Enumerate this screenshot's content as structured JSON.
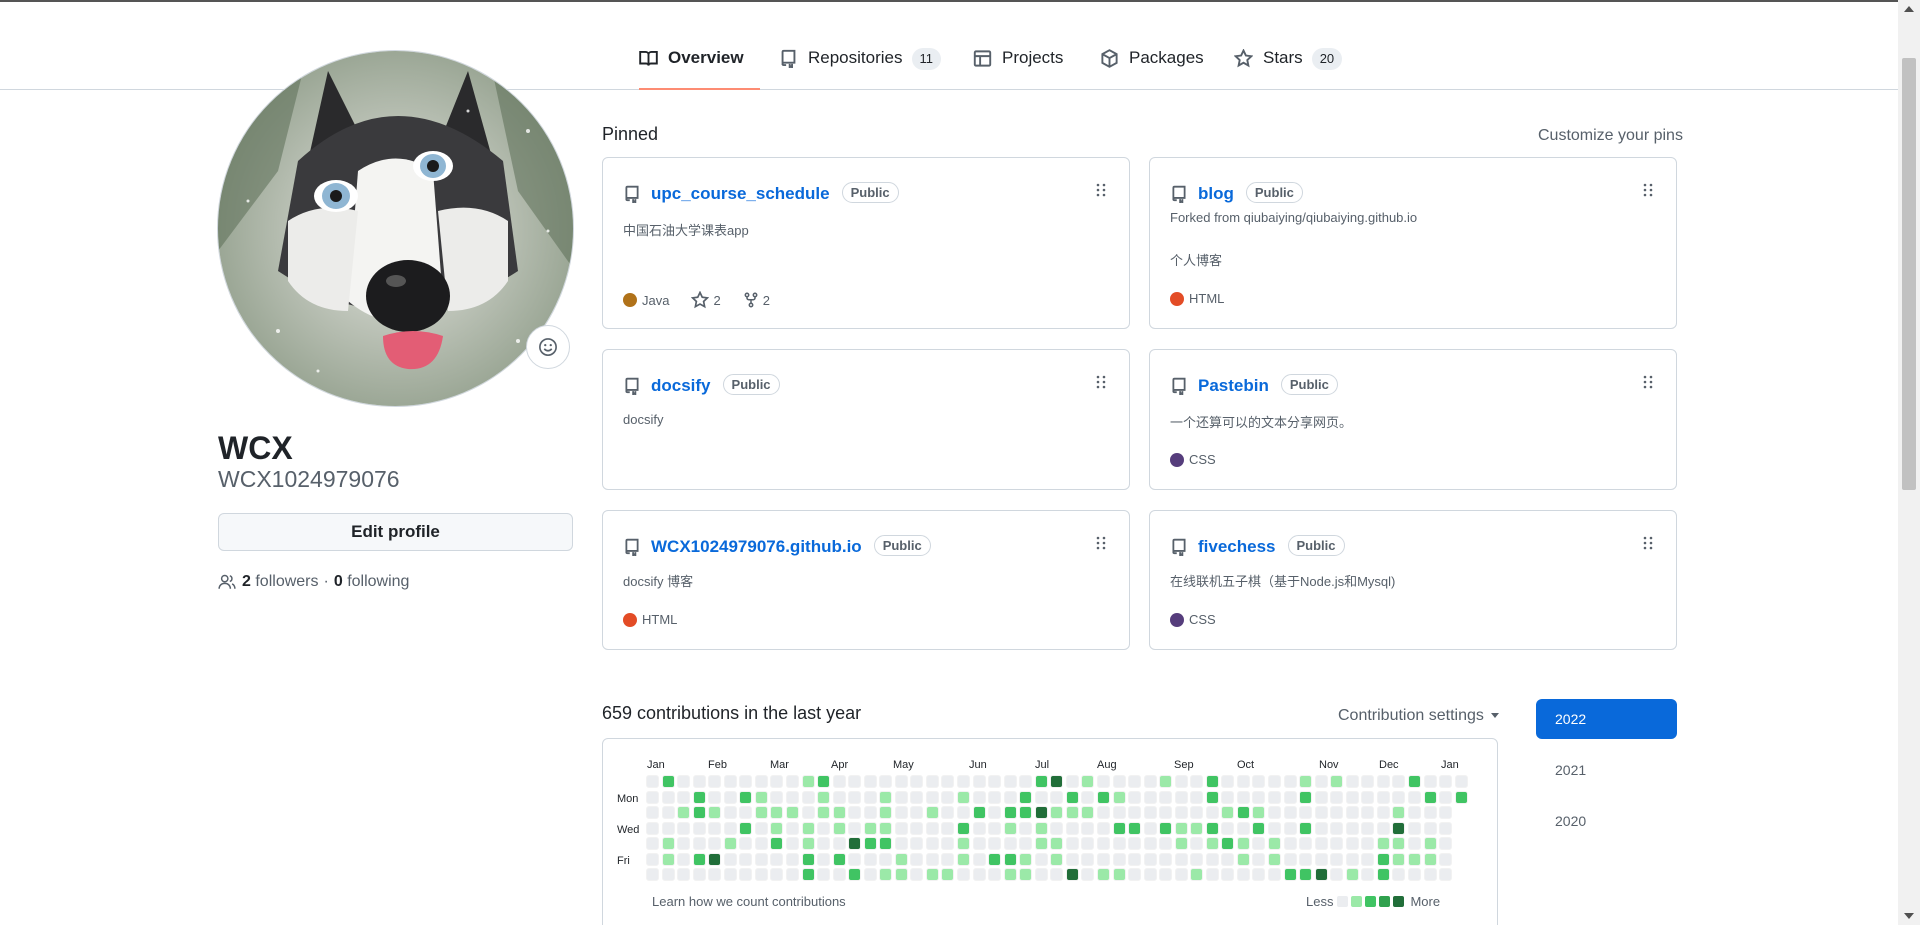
{
  "tabs": [
    {
      "label": "Overview",
      "icon": "book-icon",
      "active": true
    },
    {
      "label": "Repositories",
      "icon": "repo-icon",
      "count": "11"
    },
    {
      "label": "Projects",
      "icon": "table-icon"
    },
    {
      "label": "Packages",
      "icon": "package-icon"
    },
    {
      "label": "Stars",
      "icon": "star-icon",
      "count": "20"
    }
  ],
  "profile": {
    "avatar": "husky-dog-avatar",
    "name": "WCX",
    "login": "WCX1024979076",
    "edit_label": "Edit profile",
    "followers_count": "2",
    "followers_label": "followers",
    "separator": "·",
    "following_count": "0",
    "following_label": "following"
  },
  "pinned": {
    "title": "Pinned",
    "customize_label": "Customize your pins",
    "visibility_label": "Public",
    "cards": [
      {
        "name": "upc_course_schedule",
        "desc": "中国石油大学课表app",
        "lang": "Java",
        "lang_color": "#b07219",
        "stars": "2",
        "forks": "2"
      },
      {
        "name": "blog",
        "fork_note": "Forked from qiubaiying/qiubaiying.github.io",
        "desc": "个人博客",
        "lang": "HTML",
        "lang_color": "#e34c26"
      },
      {
        "name": "docsify",
        "desc": "docsify"
      },
      {
        "name": "Pastebin",
        "desc": "一个还算可以的文本分享网页。",
        "lang": "CSS",
        "lang_color": "#563d7c"
      },
      {
        "name": "WCX1024979076.github.io",
        "desc": "docsify 博客",
        "lang": "HTML",
        "lang_color": "#e34c26"
      },
      {
        "name": "fivechess",
        "desc": "在线联机五子棋（基于Node.js和Mysql)",
        "lang": "CSS",
        "lang_color": "#563d7c"
      }
    ]
  },
  "contributions": {
    "title": "659 contributions in the last year",
    "settings_label": "Contribution settings",
    "months": [
      "Jan",
      "Feb",
      "Mar",
      "Apr",
      "May",
      "Jun",
      "Jul",
      "Aug",
      "Sep",
      "Oct",
      "Nov",
      "Dec",
      "Jan"
    ],
    "weekdays": [
      "Mon",
      "Wed",
      "Fri"
    ],
    "learn_label": "Learn how we count contributions",
    "less_label": "Less",
    "more_label": "More",
    "level_colors": [
      "#ebedf0",
      "#9be9a8",
      "#40c463",
      "#30a14e",
      "#216e39"
    ]
  },
  "years": [
    {
      "label": "2022",
      "selected": true
    },
    {
      "label": "2021"
    },
    {
      "label": "2020"
    }
  ]
}
